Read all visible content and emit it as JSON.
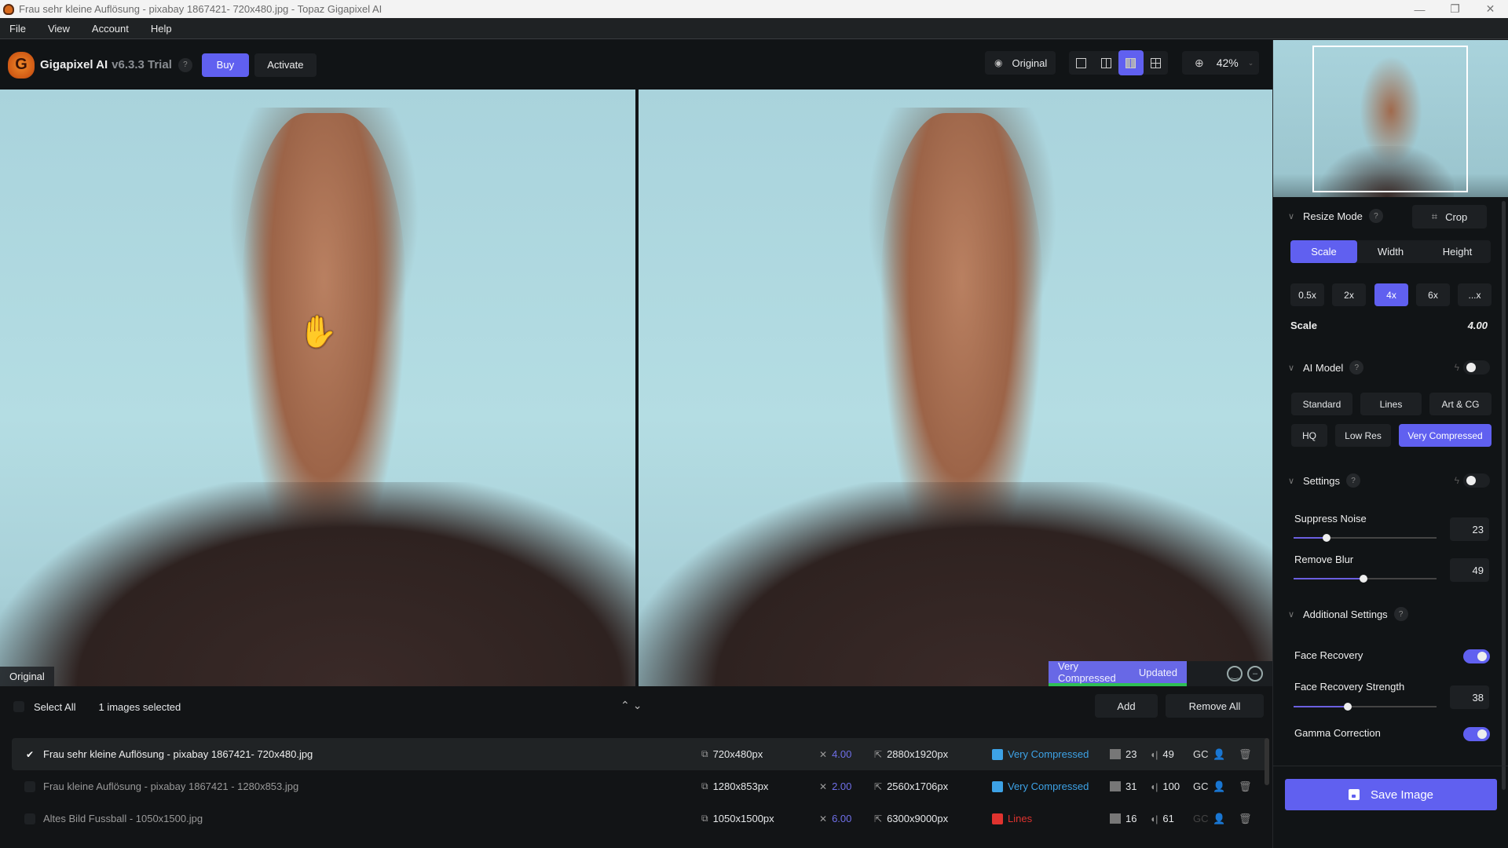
{
  "window": {
    "title": "Frau sehr kleine Auflösung - pixabay 1867421- 720x480.jpg - Topaz Gigapixel AI",
    "controls": {
      "minimize": "—",
      "maximize": "❐",
      "close": "✕"
    }
  },
  "menu": [
    "File",
    "View",
    "Account",
    "Help"
  ],
  "header": {
    "logo_letter": "G",
    "app_name": "Gigapixel AI",
    "version": "v6.3.3 Trial",
    "help": "?",
    "buy_label": "Buy",
    "activate_label": "Activate",
    "original_label": "Original",
    "view_modes": [
      "single-view",
      "split-view",
      "side-by-side-view",
      "grid-view"
    ],
    "active_view": "side-by-side-view",
    "zoom_level": "42%"
  },
  "preview": {
    "left_label": "Original",
    "model_badge": "Very Compressed",
    "status": "Updated",
    "status_color": "#2fbf55",
    "accent": "#6060f0"
  },
  "list": {
    "select_all_label": "Select All",
    "selected_count": "1 images selected",
    "add_label": "Add",
    "remove_all_label": "Remove All",
    "files": [
      {
        "name": "Frau sehr kleine Auflösung - pixabay 1867421- 720x480.jpg",
        "checked": true,
        "input": "720x480px",
        "scale": "4.00",
        "output": "2880x1920px",
        "model": "Very Compressed",
        "model_color": "#3da2e6",
        "noise": "23",
        "blur": "49",
        "gc": "GC",
        "gc_active": true
      },
      {
        "name": "Frau kleine Auflösung - pixabay 1867421 - 1280x853.jpg",
        "checked": false,
        "input": "1280x853px",
        "scale": "2.00",
        "output": "2560x1706px",
        "model": "Very Compressed",
        "model_color": "#3da2e6",
        "noise": "31",
        "blur": "100",
        "gc": "GC",
        "gc_active": true
      },
      {
        "name": "Altes Bild Fussball - 1050x1500.jpg",
        "checked": false,
        "input": "1050x1500px",
        "scale": "6.00",
        "output": "6300x9000px",
        "model": "Lines",
        "model_color": "#e0332f",
        "noise": "16",
        "blur": "61",
        "gc": "GC",
        "gc_active": false
      }
    ]
  },
  "panel": {
    "resize_mode": {
      "title": "Resize Mode",
      "help": "?",
      "crop_label": "Crop",
      "modes": [
        "Scale",
        "Width",
        "Height"
      ],
      "active_mode": "Scale",
      "presets": [
        "0.5x",
        "2x",
        "4x",
        "6x",
        "...x"
      ],
      "active_preset": "4x",
      "scale_label": "Scale",
      "scale_value": "4.00"
    },
    "ai_model": {
      "title": "AI Model",
      "help": "?",
      "auto": false,
      "row1": [
        "Standard",
        "Lines",
        "Art & CG"
      ],
      "row2": [
        "HQ",
        "Low Res",
        "Very Compressed"
      ],
      "active": "Very Compressed"
    },
    "settings": {
      "title": "Settings",
      "help": "?",
      "auto": false,
      "suppress_noise_label": "Suppress Noise",
      "suppress_noise": "23",
      "suppress_noise_pct": 23,
      "remove_blur_label": "Remove Blur",
      "remove_blur": "49",
      "remove_blur_pct": 49
    },
    "additional": {
      "title": "Additional Settings",
      "help": "?",
      "face_recovery_label": "Face Recovery",
      "face_recovery": true,
      "face_strength_label": "Face Recovery Strength",
      "face_strength": "38",
      "face_strength_pct": 38,
      "gamma_label": "Gamma Correction",
      "gamma": true
    },
    "save_label": "Save Image"
  }
}
